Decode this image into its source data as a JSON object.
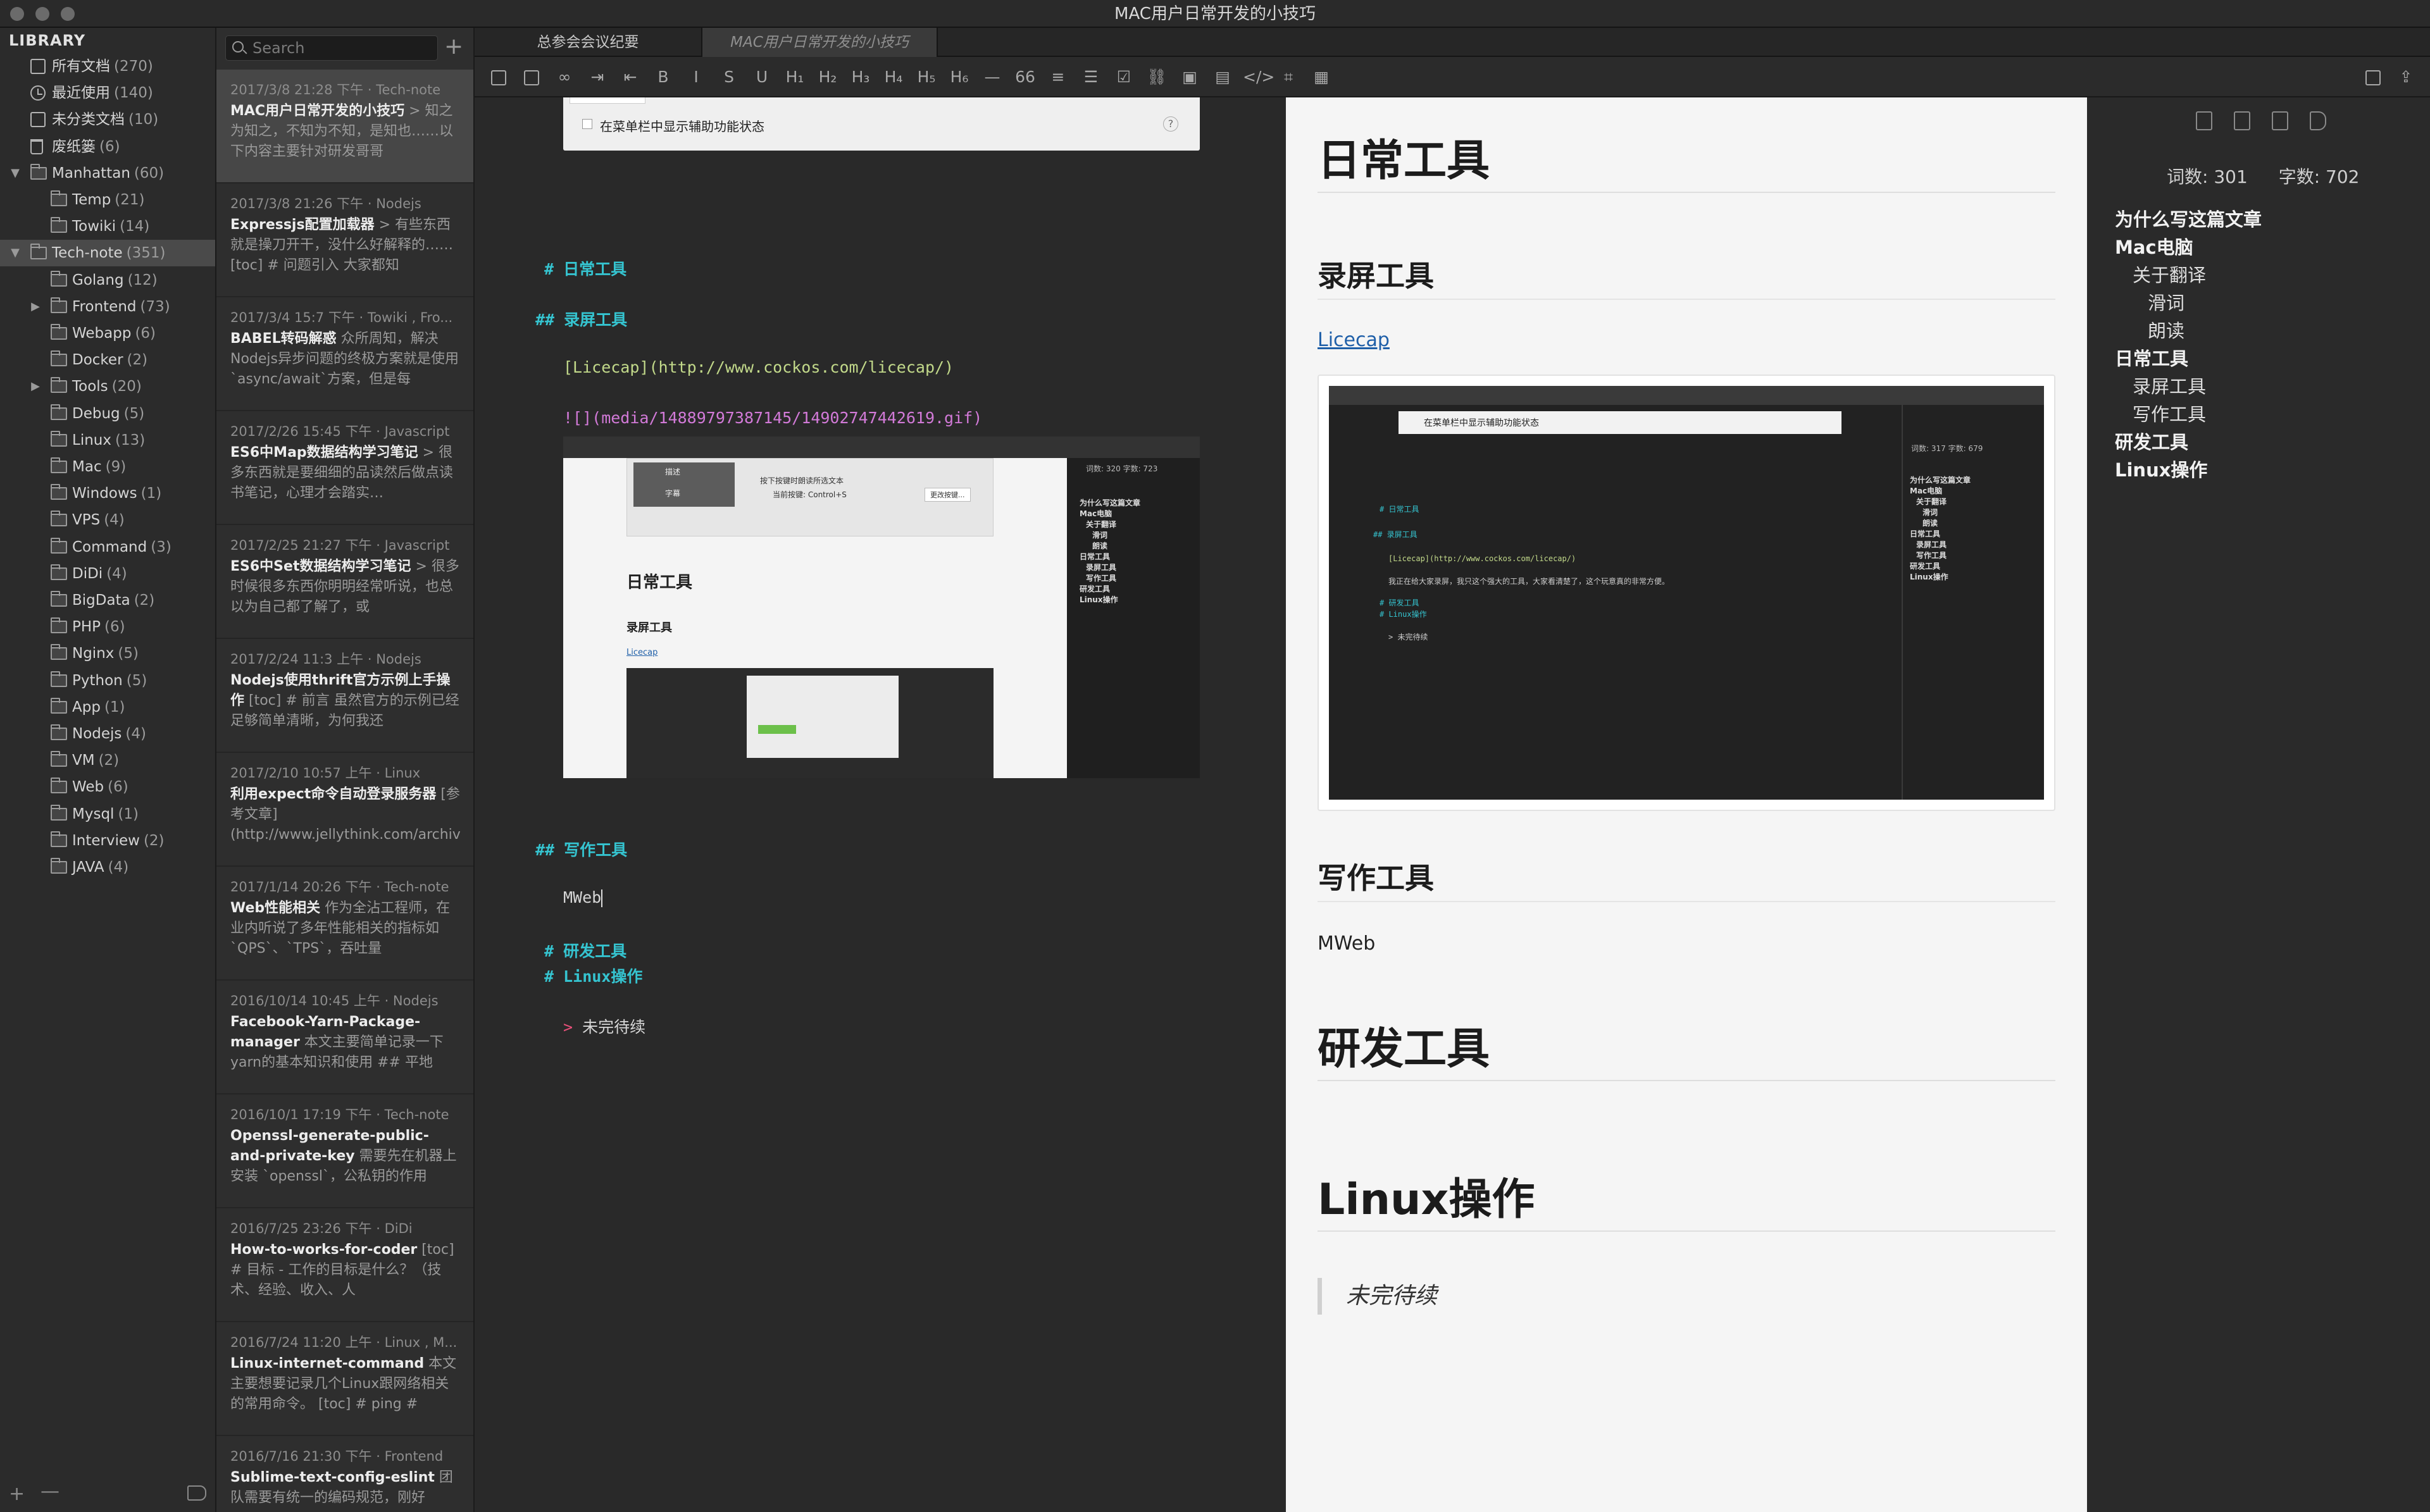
{
  "window": {
    "title": "MAC用户日常开发的小技巧"
  },
  "library": {
    "header": "LIBRARY",
    "items": [
      {
        "label": "所有文档",
        "count": "(270)",
        "icon": "document-icon"
      },
      {
        "label": "最近使用",
        "count": "(140)",
        "icon": "clock-icon"
      },
      {
        "label": "未分类文档",
        "count": "(10)",
        "icon": "document-icon"
      },
      {
        "label": "废纸篓",
        "count": "(6)",
        "icon": "trash-icon"
      },
      {
        "label": "Manhattan",
        "count": "(60)",
        "icon": "folder-icon"
      },
      {
        "label": "Temp",
        "count": "(21)",
        "icon": "folder-icon"
      },
      {
        "label": "Towiki",
        "count": "(14)",
        "icon": "folder-icon"
      },
      {
        "label": "Tech-note",
        "count": "(351)",
        "icon": "folder-icon"
      },
      {
        "label": "Golang",
        "count": "(12)",
        "icon": "folder-icon"
      },
      {
        "label": "Frontend",
        "count": "(73)",
        "icon": "folder-icon"
      },
      {
        "label": "Webapp",
        "count": "(6)",
        "icon": "folder-icon"
      },
      {
        "label": "Docker",
        "count": "(2)",
        "icon": "folder-icon"
      },
      {
        "label": "Tools",
        "count": "(20)",
        "icon": "folder-icon"
      },
      {
        "label": "Debug",
        "count": "(5)",
        "icon": "folder-icon"
      },
      {
        "label": "Linux",
        "count": "(13)",
        "icon": "folder-icon"
      },
      {
        "label": "Mac",
        "count": "(9)",
        "icon": "folder-icon"
      },
      {
        "label": "Windows",
        "count": "(1)",
        "icon": "folder-icon"
      },
      {
        "label": "VPS",
        "count": "(4)",
        "icon": "folder-icon"
      },
      {
        "label": "Command",
        "count": "(3)",
        "icon": "folder-icon"
      },
      {
        "label": "DiDi",
        "count": "(4)",
        "icon": "folder-icon"
      },
      {
        "label": "BigData",
        "count": "(2)",
        "icon": "folder-icon"
      },
      {
        "label": "PHP",
        "count": "(6)",
        "icon": "folder-icon"
      },
      {
        "label": "Nginx",
        "count": "(5)",
        "icon": "folder-icon"
      },
      {
        "label": "Python",
        "count": "(5)",
        "icon": "folder-icon"
      },
      {
        "label": "App",
        "count": "(1)",
        "icon": "folder-icon"
      },
      {
        "label": "Nodejs",
        "count": "(4)",
        "icon": "folder-icon"
      },
      {
        "label": "VM",
        "count": "(2)",
        "icon": "folder-icon"
      },
      {
        "label": "Web",
        "count": "(6)",
        "icon": "folder-icon"
      },
      {
        "label": "Mysql",
        "count": "(1)",
        "icon": "folder-icon"
      },
      {
        "label": "Interview",
        "count": "(2)",
        "icon": "folder-icon"
      },
      {
        "label": "JAVA",
        "count": "(4)",
        "icon": "folder-icon"
      }
    ],
    "selected": "Tech-note",
    "footer": {
      "add": "+",
      "remove": "—"
    }
  },
  "notes": {
    "search_placeholder": "Search",
    "add_label": "+",
    "items": [
      {
        "meta": "2017/3/8 21:28 下午 · Tech-note",
        "title": "MAC用户日常开发的小技巧",
        "excerpt": " > 知之为知之，不知为不知，是知也……以下内容主要针对研发哥哥"
      },
      {
        "meta": "2017/3/8 21:26 下午 · Nodejs",
        "title": "Expressjs配置加载器",
        "excerpt": " > 有些东西就是操刀开干，没什么好解释的…… [toc] # 问题引入  大家都知"
      },
      {
        "meta": "2017/3/4 15:7 下午 · Towiki , Fro...",
        "title": "BABEL转码解惑",
        "excerpt": " 众所周知，解决Nodejs异步问题的终极方案就是使用`async/await`方案，但是每"
      },
      {
        "meta": "2017/2/26 15:45 下午 · Javascript",
        "title": "ES6中Map数据结构学习笔记",
        "excerpt": " > 很多东西就是要细细的品读然后做点读书笔记，心理才会踏实…"
      },
      {
        "meta": "2017/2/25 21:27 下午 · Javascript",
        "title": "ES6中Set数据结构学习笔记",
        "excerpt": " > 很多时候很多东西你明明经常听说，也总以为自己都了解了，或"
      },
      {
        "meta": "2017/2/24 11:3 上午 · Nodejs",
        "title": "Nodejs使用thrift官方示例上手操作",
        "excerpt": " [toc] # 前言  虽然官方的示例已经足够简单清晰，为何我还"
      },
      {
        "meta": "2017/2/10 10:57 上午 · Linux",
        "title": "利用expect命令自动登录服务器",
        "excerpt": " [参考文章](http://www.jellythink.com/archives/"
      },
      {
        "meta": "2017/1/14 20:26 下午 · Tech-note",
        "title": "Web性能相关",
        "excerpt": " 作为全沾工程师，在业内听说了多年性能相关的指标如 `QPS`、`TPS`，吞吐量"
      },
      {
        "meta": "2016/10/14 10:45 上午 · Nodejs",
        "title": "Facebook-Yarn-Package-manager",
        "excerpt": " 本文主要简单记录一下yarn的基本知识和使用 ## 平地"
      },
      {
        "meta": "2016/10/1 17:19 下午 · Tech-note",
        "title": "Openssl-generate-public-and-private-key",
        "excerpt": " 需要先在机器上安装 `openssl`，公私钥的作用"
      },
      {
        "meta": "2016/7/25 23:26 下午 · DiDi",
        "title": "How-to-works-for-coder",
        "excerpt": " [toc] # 目标 - 工作的目标是什么？（技术、经验、收入、人"
      },
      {
        "meta": "2016/7/24 11:20 上午 · Linux , M...",
        "title": "Linux-internet-command",
        "excerpt": " 本文主要想要记录几个Linux跟网络相关的常用命令。 [toc] # ping #"
      },
      {
        "meta": "2016/7/16 21:30 下午 · Frontend",
        "title": "Sublime-text-config-eslint",
        "excerpt": " 团队需要有统一的编码规范，刚好"
      }
    ]
  },
  "tabs": [
    {
      "label": "总参会会议纪要",
      "active": true
    },
    {
      "label": "MAC用户日常开发的小技巧",
      "active": false
    }
  ],
  "toolbar": {
    "buttons": [
      {
        "name": "toggle-sidebar-icon",
        "glyph": ""
      },
      {
        "name": "split-view-icon",
        "glyph": ""
      },
      {
        "name": "focus-icon",
        "glyph": "∞"
      },
      {
        "name": "indent-icon",
        "glyph": "⇥"
      },
      {
        "name": "outdent-icon",
        "glyph": "⇤"
      },
      {
        "name": "bold-icon",
        "glyph": "B"
      },
      {
        "name": "italic-icon",
        "glyph": "I"
      },
      {
        "name": "strikethrough-icon",
        "glyph": "S"
      },
      {
        "name": "underline-icon",
        "glyph": "U"
      },
      {
        "name": "h1-icon",
        "glyph": "H₁"
      },
      {
        "name": "h2-icon",
        "glyph": "H₂"
      },
      {
        "name": "h3-icon",
        "glyph": "H₃"
      },
      {
        "name": "h4-icon",
        "glyph": "H₄"
      },
      {
        "name": "h5-icon",
        "glyph": "H₅"
      },
      {
        "name": "h6-icon",
        "glyph": "H₆"
      },
      {
        "name": "horizontal-rule-icon",
        "glyph": "—"
      },
      {
        "name": "quote-icon",
        "glyph": "66"
      },
      {
        "name": "ordered-list-icon",
        "glyph": "≡"
      },
      {
        "name": "unordered-list-icon",
        "glyph": "☰"
      },
      {
        "name": "checkbox-icon",
        "glyph": "☑"
      },
      {
        "name": "link-icon",
        "glyph": "⛓"
      },
      {
        "name": "image-icon",
        "glyph": "▣"
      },
      {
        "name": "image-upload-icon",
        "glyph": "▤"
      },
      {
        "name": "code-icon",
        "glyph": "</>"
      },
      {
        "name": "crop-icon",
        "glyph": "⌗"
      },
      {
        "name": "table-icon",
        "glyph": "▦"
      }
    ],
    "right": [
      {
        "name": "toggle-outline-icon",
        "glyph": ""
      },
      {
        "name": "share-icon",
        "glyph": "⇪"
      }
    ]
  },
  "editor": {
    "shot_top_text": "在菜单栏中显示辅助功能状态",
    "h1_daily": "# 日常工具",
    "h2_record": "## 录屏工具",
    "licecap_link": "[Licecap](http://www.cockos.com/licecap/)",
    "image_md": "![](media/14889797387145/14902747442619.gif)",
    "h2_write": "## 写作工具",
    "mweb_text": "MWeb",
    "h1_dev": "# 研发工具",
    "h1_linux": "# Linux操作",
    "quote_mark": ">",
    "quote_text": "未完待续",
    "nested": {
      "h_daily": "日常工具",
      "h_record": "录屏工具",
      "link": "Licecap",
      "stats": "词数: 320    字数: 723",
      "option1": "按下按键时朗读所选文本",
      "option2": "当前按键:  Control+S",
      "option_btn": "更改按键...",
      "menu1": "描述",
      "menu2": "字幕",
      "toc": [
        "为什么写这篇文章",
        "Mac电脑",
        "关于翻译",
        "滑词",
        "朗读",
        "日常工具",
        "录屏工具",
        "写作工具",
        "研发工具",
        "Linux操作"
      ]
    }
  },
  "preview": {
    "h1_daily": "日常工具",
    "h2_record": "录屏工具",
    "licecap_link": "Licecap",
    "h2_write": "写作工具",
    "mweb_text": "MWeb",
    "h1_dev": "研发工具",
    "h1_linux": "Linux操作",
    "quote": "未完待续",
    "nested": {
      "shot_text": "在菜单栏中显示辅助功能状态",
      "stats": "词数: 317    字数: 679",
      "md1": "# 日常工具",
      "md2": "## 录屏工具",
      "md3": "[Licecap](http://www.cockos.com/licecap/)",
      "md4": "我正在给大家录屏，我只这个强大的工具，大家看清楚了，这个玩意真的非常方便。",
      "md5": "# 研发工具",
      "md6": "# Linux操作",
      "md7": "> 未完待续",
      "toc": [
        "为什么写这篇文章",
        "Mac电脑",
        "关于翻译",
        "滑词",
        "朗读",
        "日常工具",
        "录屏工具",
        "写作工具",
        "研发工具",
        "Linux操作"
      ]
    }
  },
  "outline": {
    "stats": {
      "words_label": "词数: 301",
      "chars_label": "字数: 702"
    },
    "toc": [
      {
        "label": "为什么写这篇文章",
        "level": 1
      },
      {
        "label": "Mac电脑",
        "level": 1
      },
      {
        "label": "关于翻译",
        "level": 2
      },
      {
        "label": "滑词",
        "level": 3
      },
      {
        "label": "朗读",
        "level": 3
      },
      {
        "label": "日常工具",
        "level": 1
      },
      {
        "label": "录屏工具",
        "level": 2
      },
      {
        "label": "写作工具",
        "level": 2
      },
      {
        "label": "研发工具",
        "level": 1
      },
      {
        "label": "Linux操作",
        "level": 1
      }
    ]
  },
  "colors": {
    "heading_marker": "#35c4d0",
    "quote_marker": "#e8507a",
    "link_text": "#1f5fa8",
    "md_image": "#d27ad8",
    "md_link": "#c2d98a"
  }
}
